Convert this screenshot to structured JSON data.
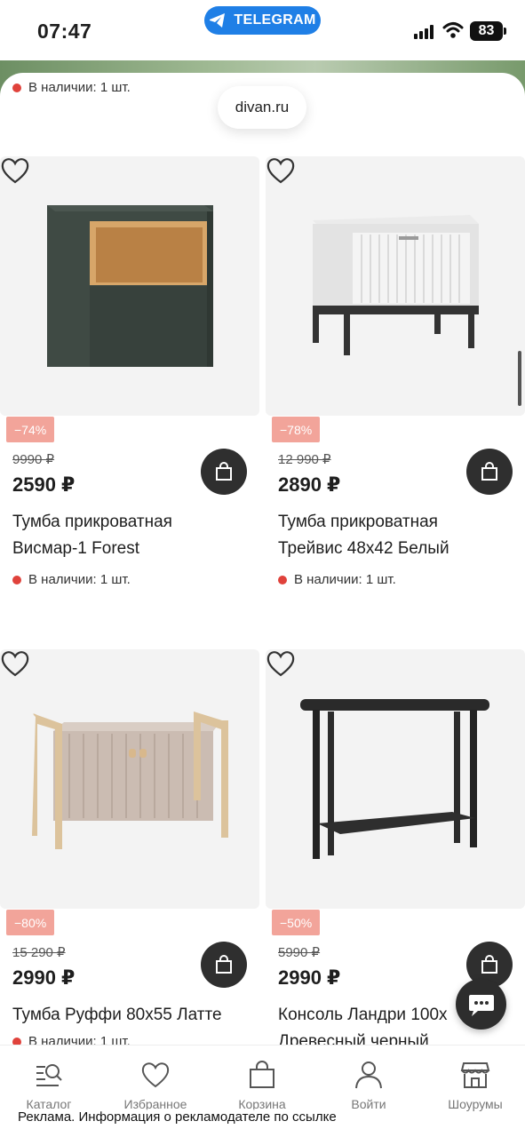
{
  "status_bar": {
    "time": "07:47",
    "telegram_label": "TELEGRAM",
    "battery": "83"
  },
  "browser": {
    "url": "divan.ru"
  },
  "top_partial": {
    "stock": "В наличии: 1 шт."
  },
  "products": [
    {
      "discount": "−74%",
      "old_price": "9990 ₽",
      "price": "2590 ₽",
      "title_line1": "Тумба прикроватная",
      "title_line2": "Висмар-1 Forest",
      "stock": "В наличии: 1 шт."
    },
    {
      "discount": "−78%",
      "old_price": "12 990 ₽",
      "price": "2890 ₽",
      "title_line1": "Тумба прикроватная",
      "title_line2": "Трейвис 48х42 Белый",
      "stock": "В наличии: 1 шт."
    },
    {
      "discount": "−80%",
      "old_price": "15 290 ₽",
      "price": "2990 ₽",
      "title_line1": "Тумба Руффи 80х55 Латте",
      "title_line2": "",
      "stock": "В наличии: 1 шт."
    },
    {
      "discount": "−50%",
      "old_price": "5990 ₽",
      "price": "2990 ₽",
      "title_line1": "Консоль Ландри 100х",
      "title_line2": "Древесный черный",
      "stock": ""
    }
  ],
  "nav": {
    "items": [
      {
        "label": "Каталог",
        "icon": "catalog-search-icon"
      },
      {
        "label": "Избранное",
        "icon": "heart-icon"
      },
      {
        "label": "Корзина",
        "icon": "bag-icon"
      },
      {
        "label": "Войти",
        "icon": "user-icon"
      },
      {
        "label": "Шоурумы",
        "icon": "store-icon"
      }
    ]
  },
  "ad_notice": "Реклама. Информация о рекламодателе по ссылке",
  "colors": {
    "badge": "#f2a49a",
    "stock_dot": "#e0423b",
    "cart_button": "#2f2f2f",
    "telegram": "#1f7fe6"
  }
}
